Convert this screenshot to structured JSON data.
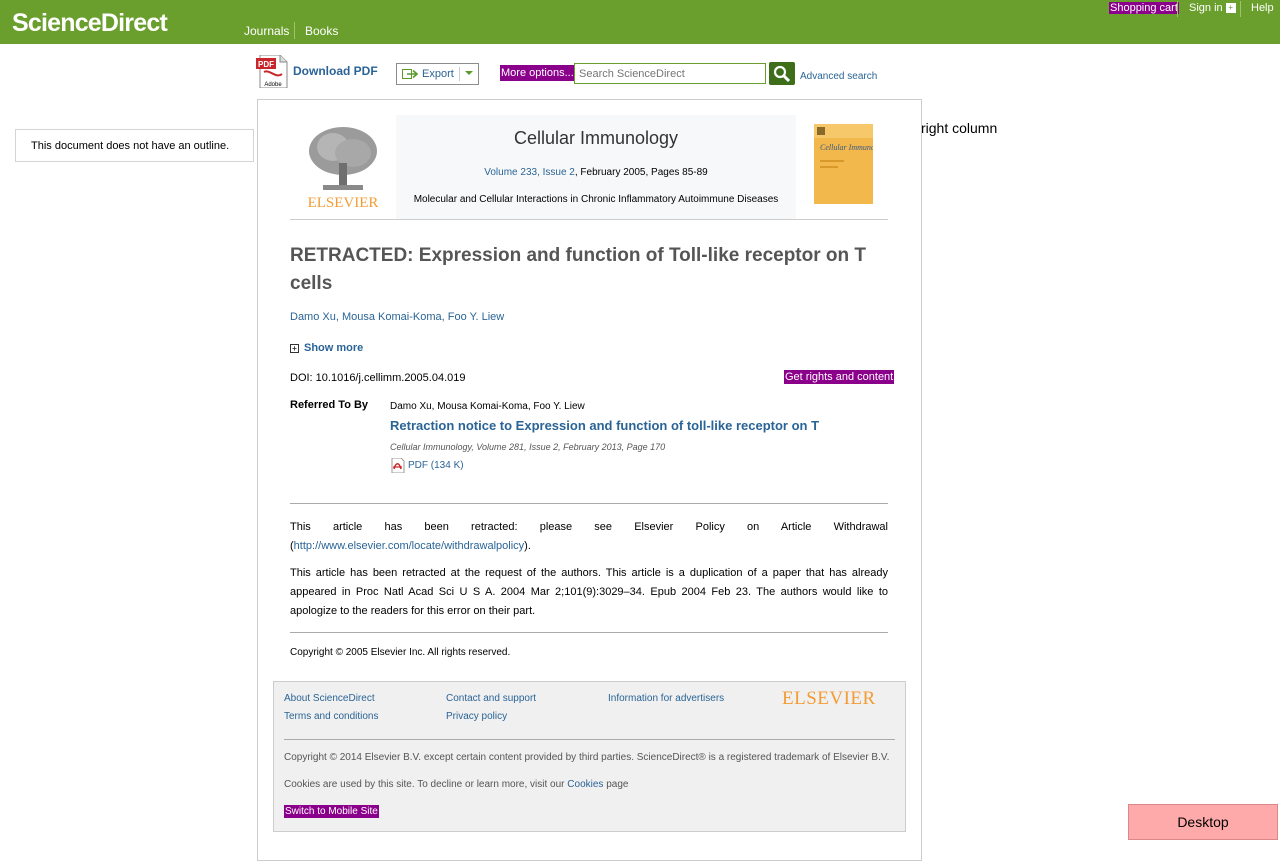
{
  "header": {
    "logo": "ScienceDirect",
    "nav": [
      "Journals",
      "Books"
    ],
    "shopping_cart": "Shopping cart",
    "sign_in": "Sign in",
    "help": "Help"
  },
  "toolbar": {
    "download_pdf": "Download PDF",
    "pdf_icon_top": "PDF",
    "pdf_icon_bottom": "Adobe",
    "export": "Export",
    "more_options": "More options...",
    "search_placeholder": "Search ScienceDirect",
    "advanced_search": "Advanced search"
  },
  "sidebar": {
    "outline_message": "This document does not have an outline."
  },
  "right_column": "right column",
  "journal": {
    "publisher": "ELSEVIER",
    "title": "Cellular Immunology",
    "volume_link": "Volume 233, Issue 2",
    "date_pages": ", February 2005, Pages 85-89",
    "special_issue": "Molecular and Cellular Interactions in Chronic Inflammatory Autoimmune Diseases",
    "cover_title": "Cellular Immunology"
  },
  "article": {
    "title": "RETRACTED: Expression and function of Toll-like receptor on T cells",
    "authors": [
      "Damo Xu",
      "Mousa Komai-Koma",
      "Foo Y. Liew"
    ],
    "author_sep": ", ",
    "show_more": "Show more",
    "doi": "DOI: 10.1016/j.cellimm.2005.04.019",
    "rights": "Get rights and content",
    "referred_label": "Referred To By",
    "ref_authors": "Damo Xu, Mousa Komai-Koma, Foo Y. Liew",
    "ref_title": "Retraction notice to Expression and function of toll-like receptor on T",
    "ref_cite": "Cellular Immunology, Volume 281, Issue 2, February 2013, Page 170",
    "ref_pdf": "PDF (134 K)",
    "para1_text": "This article has been retracted: please see Elsevier Policy on Article Withdrawal (",
    "para1_link": "http://www.elsevier.com/locate/withdrawalpolicy",
    "para1_end": ").",
    "para2": "This article has been retracted at the request of the authors. This article is a duplication of a paper that has already appeared in Proc Natl Acad Sci U S A. 2004 Mar 2;101(9):3029–34. Epub 2004 Feb 23. The authors would like to apologize to the readers for this error on their part.",
    "copyright": "Copyright © 2005 Elsevier Inc. All rights reserved."
  },
  "footer": {
    "links": {
      "about": "About ScienceDirect",
      "terms": "Terms and conditions",
      "contact": "Contact and support",
      "privacy": "Privacy policy",
      "advertisers": "Information for advertisers"
    },
    "brand": "ELSEVIER",
    "copyright": "Copyright © 2014 Elsevier B.V. except certain content provided by third parties. ScienceDirect® is a registered trademark of Elsevier B.V.",
    "cookies_pre": "Cookies are used by this site. To decline or learn more, visit our ",
    "cookies_link": "Cookies",
    "cookies_post": " page",
    "mobile": "Switch to Mobile Site"
  },
  "desktop_button": "Desktop",
  "colors": {
    "header_green": "#6a9f2e",
    "link_blue": "#2a6496",
    "highlight_purple": "#8b008b",
    "elsevier_orange": "#f39c34"
  }
}
